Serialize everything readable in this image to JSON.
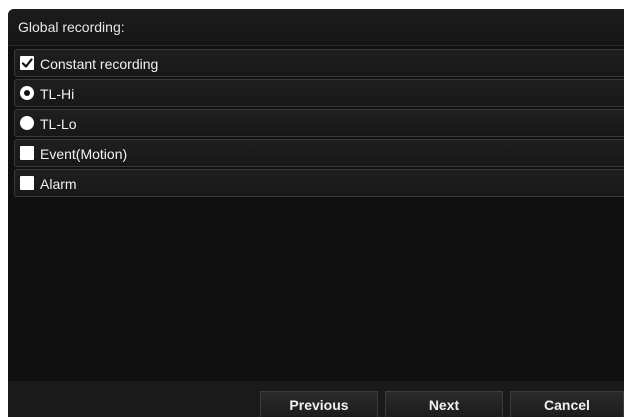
{
  "header": {
    "title": "Global recording:"
  },
  "options": [
    {
      "type": "checkbox",
      "label": "Constant recording",
      "checked": true
    },
    {
      "type": "radio",
      "label": "TL-Hi",
      "selected": true
    },
    {
      "type": "radio",
      "label": "TL-Lo",
      "selected": false
    },
    {
      "type": "checkbox",
      "label": "Event(Motion)",
      "checked": false
    },
    {
      "type": "checkbox",
      "label": "Alarm",
      "checked": false
    }
  ],
  "footer": {
    "previous_label": "Previous",
    "next_label": "Next",
    "cancel_label": "Cancel"
  }
}
